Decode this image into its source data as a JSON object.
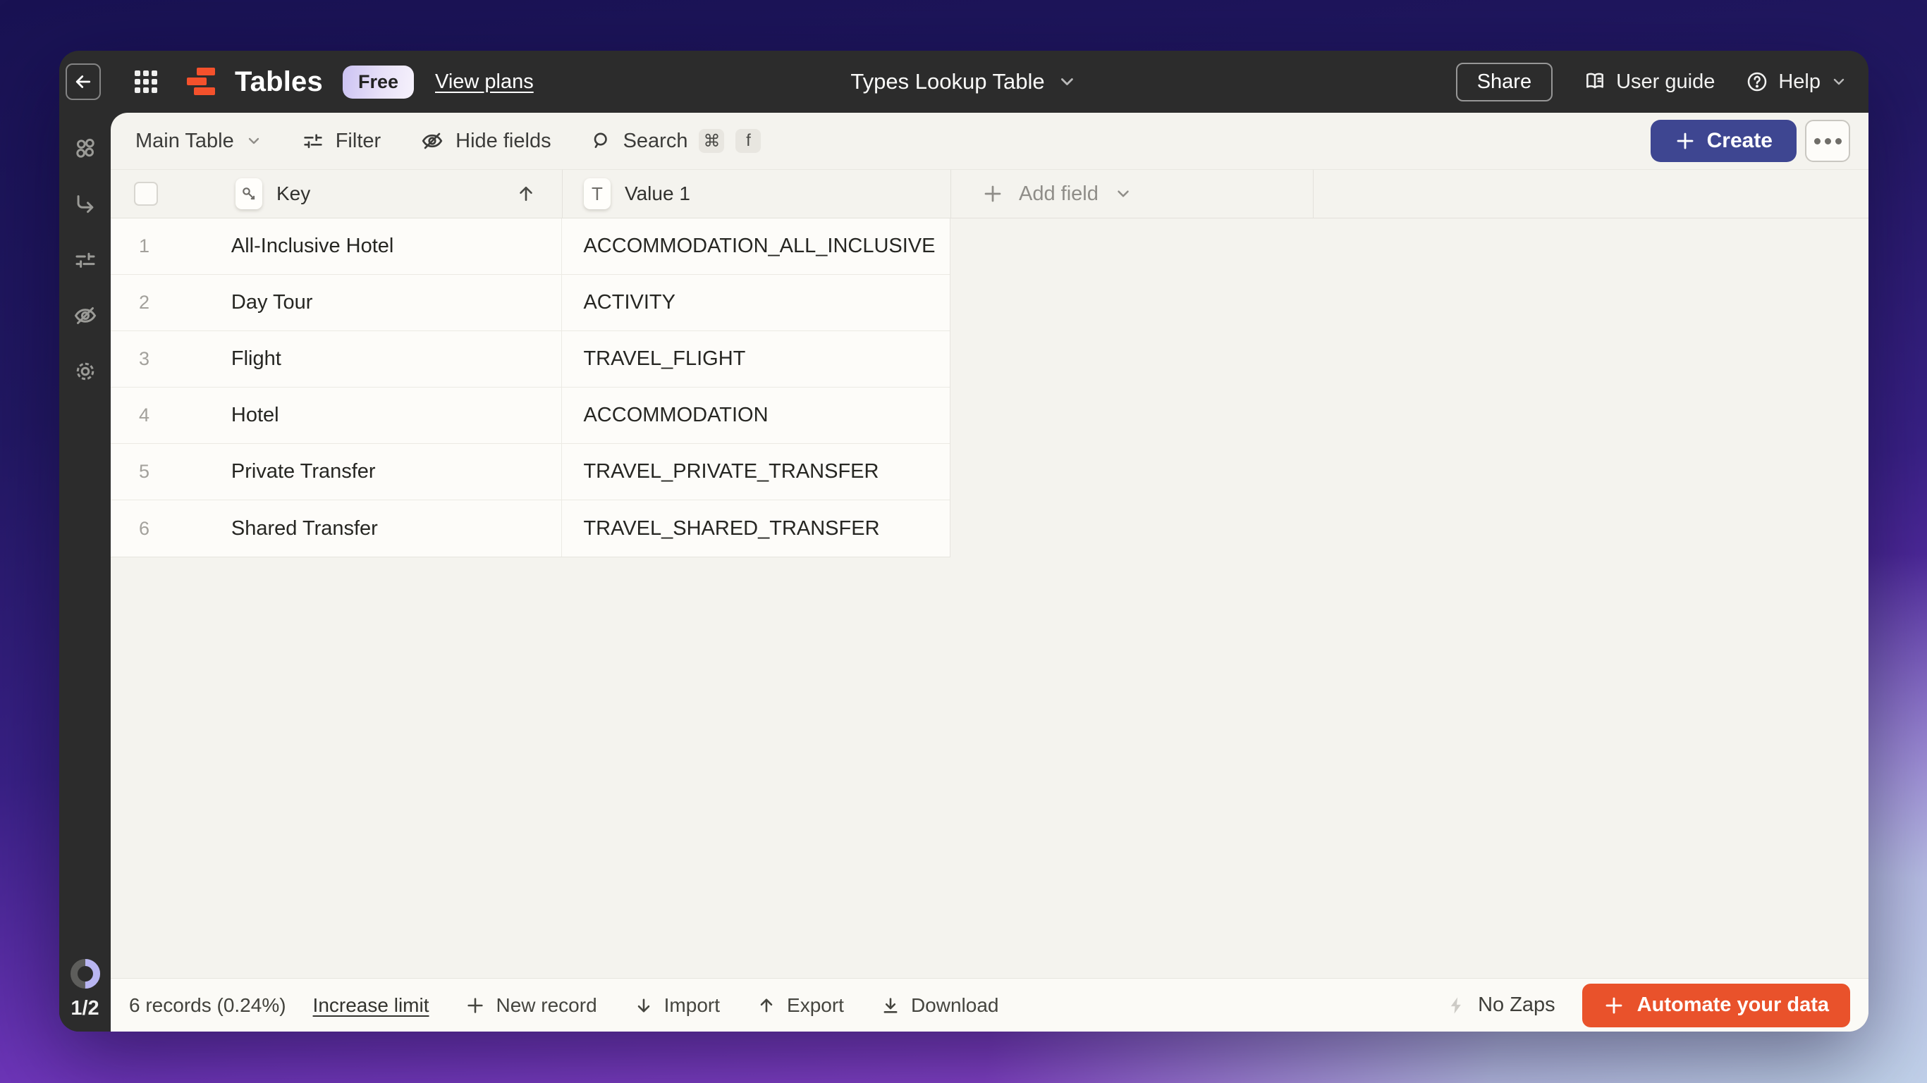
{
  "titlebar": {
    "app_title": "Tables",
    "plan_badge": "Free",
    "view_plans": "View plans",
    "table_title": "Types Lookup Table",
    "share": "Share",
    "user_guide": "User guide",
    "help": "Help"
  },
  "toolbar": {
    "table_selector": "Main Table",
    "filter": "Filter",
    "hide_fields": "Hide fields",
    "search": "Search",
    "shortcut_mod": "⌘",
    "shortcut_key": "f",
    "create": "Create"
  },
  "table": {
    "columns": [
      {
        "name": "Key",
        "type": "key"
      },
      {
        "name": "Value 1",
        "type": "text",
        "badge_letter": "T"
      }
    ],
    "add_field": "Add field",
    "rows": [
      {
        "num": "1",
        "key": "All-Inclusive Hotel",
        "value": "ACCOMMODATION_ALL_INCLUSIVE"
      },
      {
        "num": "2",
        "key": "Day Tour",
        "value": "ACTIVITY"
      },
      {
        "num": "3",
        "key": "Flight",
        "value": "TRAVEL_FLIGHT"
      },
      {
        "num": "4",
        "key": "Hotel",
        "value": "ACCOMMODATION"
      },
      {
        "num": "5",
        "key": "Private Transfer",
        "value": "TRAVEL_PRIVATE_TRANSFER"
      },
      {
        "num": "6",
        "key": "Shared Transfer",
        "value": "TRAVEL_SHARED_TRANSFER"
      }
    ]
  },
  "sidebar": {
    "usage": "1/2"
  },
  "statusbar": {
    "records_summary": "6 records (0.24%)",
    "increase_limit": "Increase limit",
    "new_record": "New record",
    "import": "Import",
    "export": "Export",
    "download": "Download",
    "zaps_status": "No Zaps",
    "automate": "Automate your data"
  },
  "colors": {
    "chrome_dark": "#2c2c2c",
    "content_cream": "#f4f3ee",
    "cell_white": "#fdfcf9",
    "accent_indigo": "#3e4691",
    "brand_orange": "#f4512c",
    "automate_orange": "#e9522b",
    "badge_lavender": "#cbc2f2"
  }
}
